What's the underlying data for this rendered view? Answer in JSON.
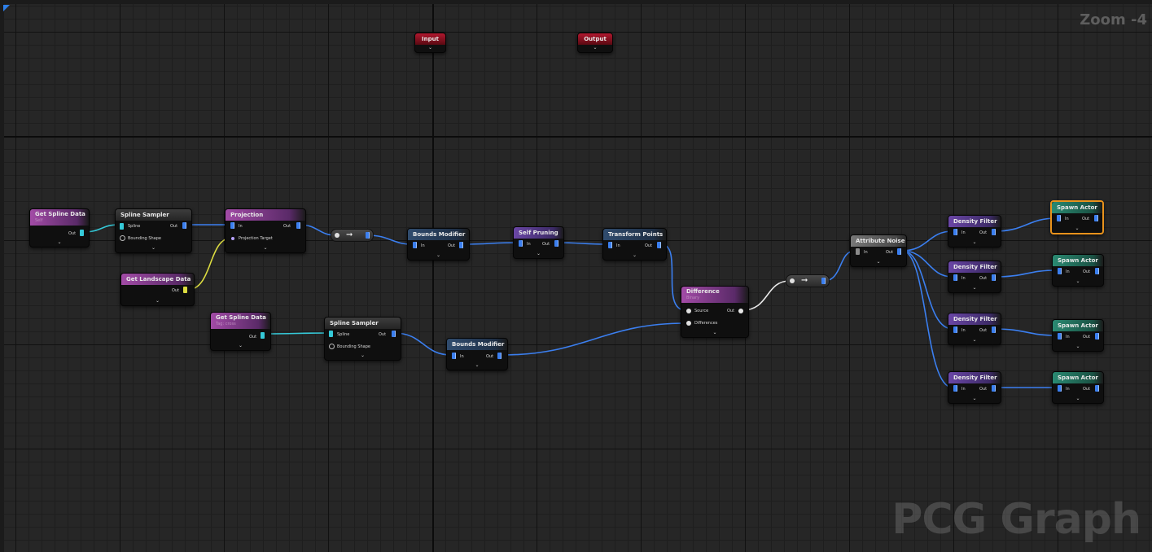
{
  "editor": {
    "zoom_label": "Zoom -4",
    "watermark": "PCG Graph"
  },
  "pins": {
    "out": "Out",
    "in": "In",
    "spline": "Spline",
    "bounding_shape": "Bounding Shape",
    "projection_target": "Projection Target",
    "source": "Source",
    "differences": "Differences"
  },
  "nodes": {
    "input": {
      "title": "Input"
    },
    "output": {
      "title": "Output"
    },
    "get_spline_data_1": {
      "title": "Get Spline Data",
      "subtitle": "Self"
    },
    "spline_sampler_1": {
      "title": "Spline Sampler"
    },
    "projection": {
      "title": "Projection"
    },
    "get_landscape_data": {
      "title": "Get Landscape Data"
    },
    "get_spline_data_2": {
      "title": "Get Spline Data",
      "subtitle": "Tag: cross"
    },
    "spline_sampler_2": {
      "title": "Spline Sampler"
    },
    "bounds_modifier_1": {
      "title": "Bounds Modifier"
    },
    "bounds_modifier_2": {
      "title": "Bounds Modifier"
    },
    "self_pruning": {
      "title": "Self Pruning"
    },
    "transform_points": {
      "title": "Transform Points"
    },
    "difference": {
      "title": "Difference",
      "subtitle": "Binary"
    },
    "attribute_noise": {
      "title": "Attribute Noise"
    },
    "density_filter_1": {
      "title": "Density Filter"
    },
    "density_filter_2": {
      "title": "Density Filter"
    },
    "density_filter_3": {
      "title": "Density Filter"
    },
    "density_filter_4": {
      "title": "Density Filter"
    },
    "spawn_actor_1": {
      "title": "Spawn Actor"
    },
    "spawn_actor_2": {
      "title": "Spawn Actor"
    },
    "spawn_actor_3": {
      "title": "Spawn Actor"
    },
    "spawn_actor_4": {
      "title": "Spawn Actor"
    }
  },
  "colors": {
    "wire_point": "#3b7ff0",
    "wire_spline": "#35c9d8",
    "wire_landscape": "#dcdc40",
    "wire_exec": "#e8e8e8",
    "selection": "#e8921c"
  }
}
